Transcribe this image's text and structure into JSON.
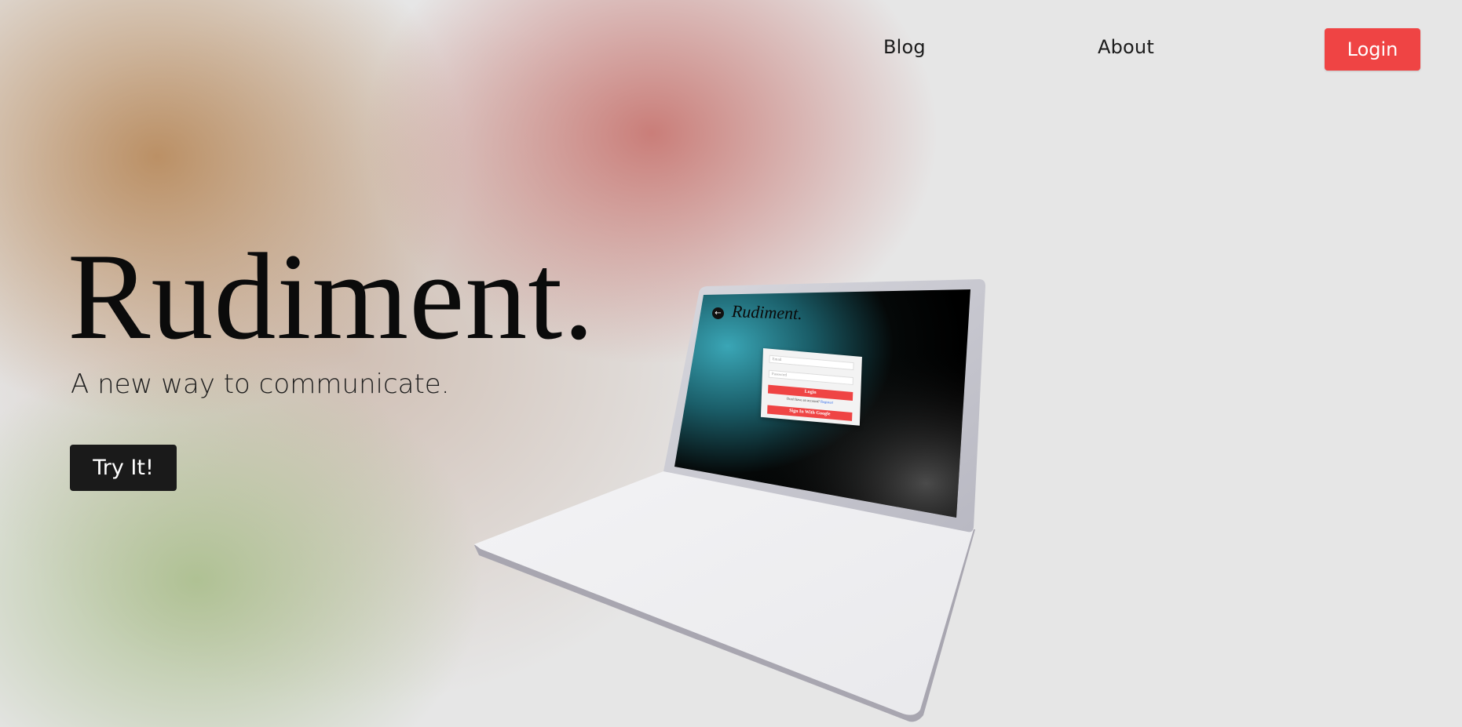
{
  "nav": {
    "links": [
      {
        "label": "Blog"
      },
      {
        "label": "About"
      }
    ],
    "login_label": "Login"
  },
  "hero": {
    "title": "Rudiment.",
    "subtitle": "A new way to communicate.",
    "cta_label": "Try It!"
  },
  "laptop_screen": {
    "logo_text": "Rudiment.",
    "back_icon": "arrow-left-icon",
    "email_placeholder": "Email",
    "password_placeholder": "Password",
    "login_label": "Login",
    "signup_prompt": "Don't have an account?",
    "signup_link": "Register!",
    "google_label": "Sign In With Google"
  },
  "colors": {
    "accent_red": "#ef4444",
    "button_dark": "#1a1a1a",
    "background": "#e6e6e6"
  }
}
